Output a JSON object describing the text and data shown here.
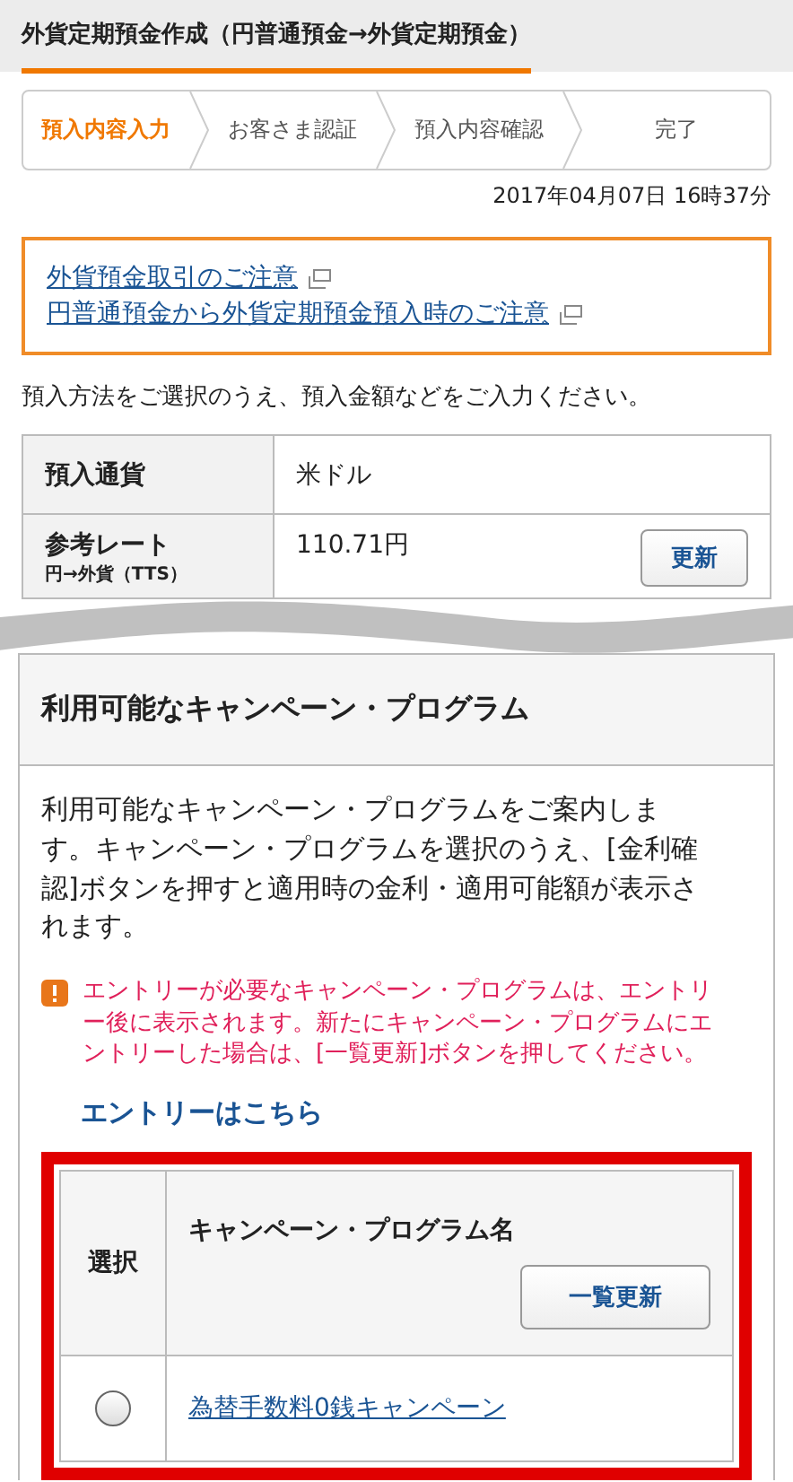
{
  "header": {
    "title": "外貨定期預金作成（円普通預金→外貨定期預金）"
  },
  "steps": [
    {
      "label": "預入内容入力",
      "selected": true
    },
    {
      "label": "お客さま認証",
      "selected": false
    },
    {
      "label": "預入内容確認",
      "selected": false
    },
    {
      "label": "完了",
      "selected": false
    }
  ],
  "timestamp": "2017年04月07日 16時37分",
  "notices": [
    "外貨預金取引のご注意",
    "円普通預金から外貨定期預金預入時のご注意"
  ],
  "instruction": "預入方法をご選択のうえ、預入金額などをご入力ください。",
  "form_rows": [
    {
      "label": "預入通貨",
      "value": "米ドル"
    },
    {
      "label": "参考レート",
      "sublabel": "円→外貨（TTS）",
      "value": "110.71円",
      "button": "更新"
    }
  ],
  "campaign": {
    "title": "利用可能なキャンペーン・プログラム",
    "description": "利用可能なキャンペーン・プログラムをご案内します。キャンペーン・プログラムを選択のうえ、[金利確認]ボタンを押すと適用時の金利・適用可能額が表示されます。",
    "warning": "エントリーが必要なキャンペーン・プログラムは、エントリー後に表示されます。新たにキャンペーン・プログラムにエントリーした場合は、[一覧更新]ボタンを押してください。",
    "entry_link": "エントリーはこちら",
    "table": {
      "columns": [
        "選択",
        "キャンペーン・プログラム名"
      ],
      "refresh_button": "一覧更新",
      "rows": [
        {
          "name": "為替手数料0銭キャンペーン",
          "selected": false
        }
      ]
    }
  }
}
